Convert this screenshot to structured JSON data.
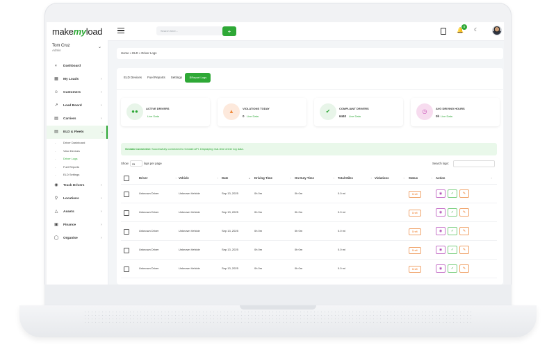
{
  "header": {
    "logo_make": "make",
    "logo_my": "my",
    "logo_load": "load",
    "search_placeholder": "Search here...",
    "search_button": "+",
    "notification_count": "0"
  },
  "user": {
    "name": "Tom Cruz",
    "role": "Admin"
  },
  "sidebar": {
    "items": [
      {
        "label": "Dashboard",
        "icon": "dashboard-icon"
      },
      {
        "label": "My Loads",
        "icon": "loads-icon"
      },
      {
        "label": "Customers",
        "icon": "customers-icon"
      },
      {
        "label": "Load Board",
        "icon": "chart-icon"
      },
      {
        "label": "Carriers",
        "icon": "truck-icon"
      },
      {
        "label": "ELD & Fleets",
        "icon": "fleet-icon"
      },
      {
        "label": "Track Drivers",
        "icon": "location-pin-icon"
      },
      {
        "label": "Locations",
        "icon": "location-icon"
      },
      {
        "label": "Assets",
        "icon": "assets-icon"
      },
      {
        "label": "Finance",
        "icon": "finance-icon"
      },
      {
        "label": "Organise",
        "icon": "organise-icon"
      }
    ],
    "sub_items": [
      "Driver Dashboard",
      "View Devices",
      "Driver Logs",
      "Fuel Reports",
      "ELD Settings"
    ]
  },
  "breadcrumb": "Home  »  ELD  »  Driver Logs",
  "tabs": [
    "ELD Devices",
    "Fuel Reports",
    "Settings",
    "Report Logs"
  ],
  "stats": [
    {
      "title": "ACTIVE DRIVERS",
      "value": "",
      "live": "Live Data",
      "color": "#e8f5e9",
      "icon_color": "#2ea836"
    },
    {
      "title": "VIOLATIONS TODAY",
      "value": "0",
      "live": "Live Data",
      "color": "#fde9dc",
      "icon_color": "#f08a3c"
    },
    {
      "title": "COMPLIANT DRIVERS",
      "value": "6440",
      "live": "Live Data",
      "color": "#e8f5e9",
      "icon_color": "#2ea836"
    },
    {
      "title": "AVG DRIVING HOURS",
      "value": "0h",
      "live": "Live Data",
      "color": "#f7dcef",
      "icon_color": "#c94fb8"
    }
  ],
  "alert": {
    "bold": "Geotab Connected:",
    "text": "Successfully connected to Geotab API. Displaying real-time driver log data."
  },
  "table": {
    "show_label": "Show",
    "show_value": "25",
    "per_page": "logs per page",
    "search_label": "Search logs:",
    "columns": [
      "Driver",
      "Vehicle",
      "Date",
      "Driving Time",
      "On Duty Time",
      "Total Miles",
      "Violations",
      "Status",
      "Action"
    ],
    "rows": [
      {
        "driver": "Unknown Driver",
        "vehicle": "Unknown Vehicle",
        "date": "Sep 13, 2025",
        "driving": "0h 0m",
        "onduty": "0h 0m",
        "miles": "0.0 mi",
        "status": "Draft"
      },
      {
        "driver": "Unknown Driver",
        "vehicle": "Unknown Vehicle",
        "date": "Sep 13, 2025",
        "driving": "0h 0m",
        "onduty": "0h 0m",
        "miles": "0.0 mi",
        "status": "Draft"
      },
      {
        "driver": "Unknown Driver",
        "vehicle": "Unknown Vehicle",
        "date": "Sep 13, 2025",
        "driving": "0h 0m",
        "onduty": "0h 0m",
        "miles": "0.0 mi",
        "status": "Draft"
      },
      {
        "driver": "Unknown Driver",
        "vehicle": "Unknown Vehicle",
        "date": "Sep 13, 2025",
        "driving": "0h 0m",
        "onduty": "0h 0m",
        "miles": "0.0 mi",
        "status": "Draft"
      },
      {
        "driver": "Unknown Driver",
        "vehicle": "Unknown Vehicle",
        "date": "Sep 13, 2025",
        "driving": "0h 0m",
        "onduty": "0h 0m",
        "miles": "0.0 mi",
        "status": "Draft"
      }
    ]
  }
}
